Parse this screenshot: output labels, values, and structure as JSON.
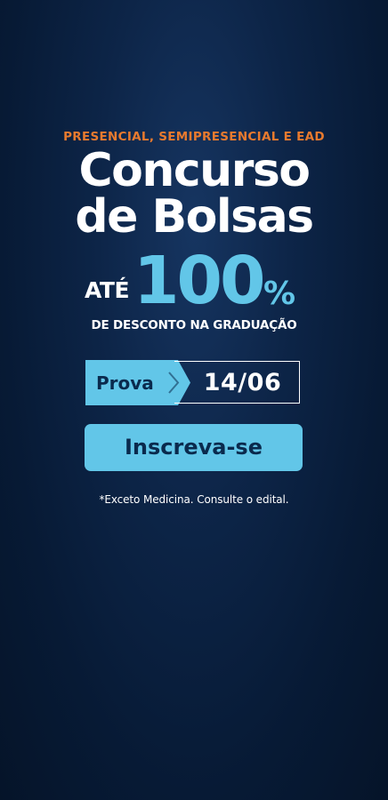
{
  "eyebrow": "PRESENCIAL, SEMIPRESENCIAL E EAD",
  "title_line1": "Concurso",
  "title_line2": "de Bolsas",
  "discount": {
    "prefix": "ATÉ",
    "value": "100",
    "suffix": "%",
    "subline": "DE DESCONTO NA GRADUAÇÃO"
  },
  "exam": {
    "label": "Prova",
    "date": "14/06"
  },
  "cta_label": "Inscreva-se",
  "disclaimer": "*Exceto Medicina. Consulte o edital.",
  "colors": {
    "accent_blue": "#62c6e8",
    "accent_orange": "#e87a2e",
    "background_navy": "#0d2548"
  }
}
